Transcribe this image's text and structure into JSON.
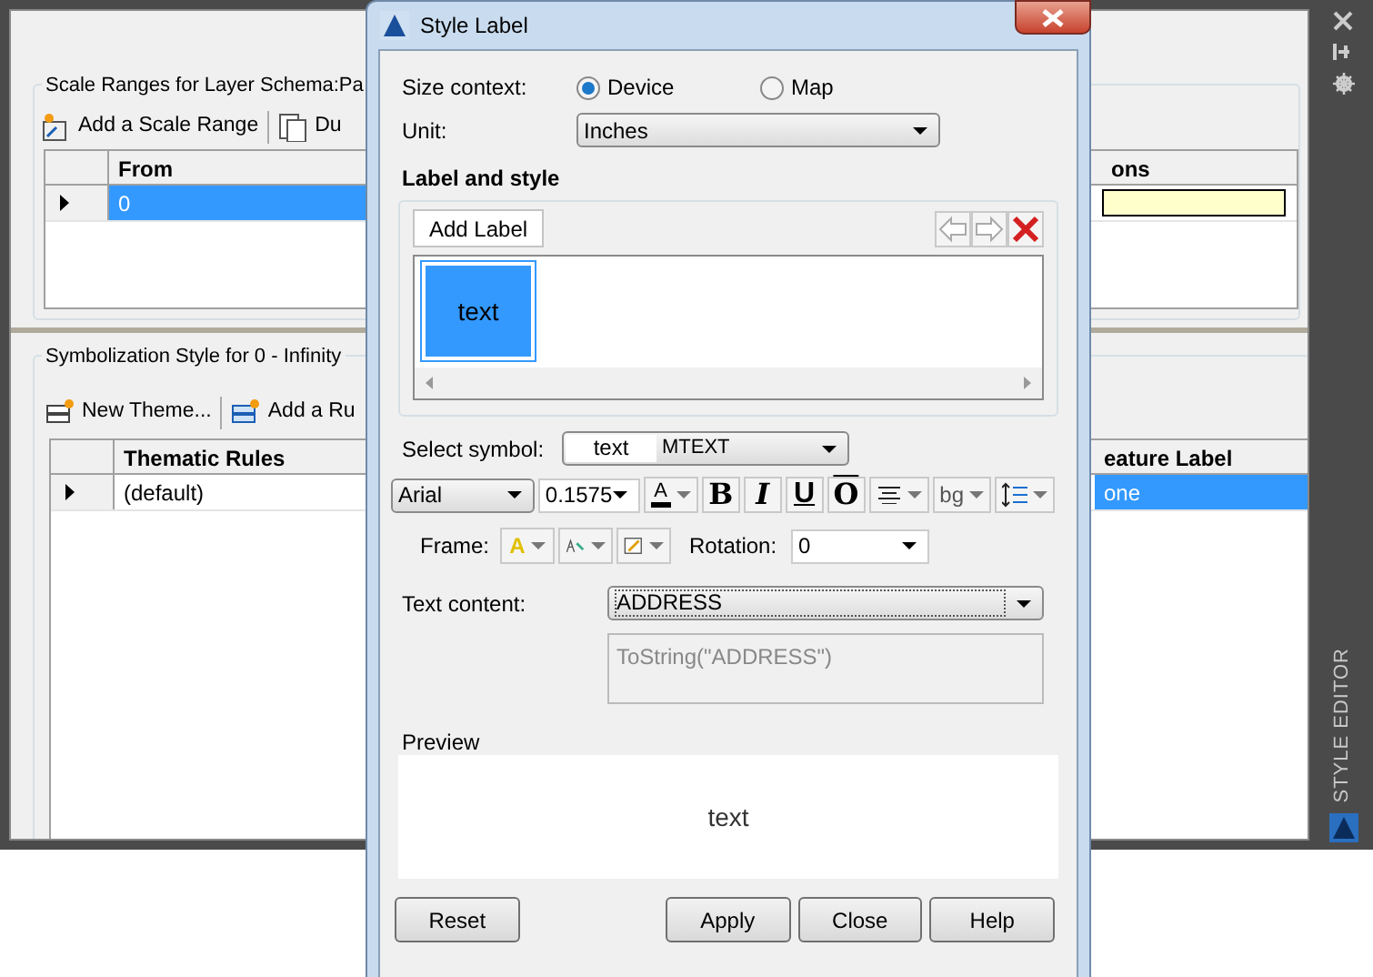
{
  "main_window": {
    "scale_ranges": {
      "title": "Scale Ranges for Layer Schema:Pa",
      "toolbar": [
        "Add a Scale Range",
        "Du"
      ],
      "columns": [
        "From",
        "ons"
      ],
      "rows": [
        {
          "cells": [
            {
              "text": "0",
              "selected": true
            }
          ],
          "editing": true
        }
      ]
    },
    "symbolization": {
      "title": "Symbolization Style for 0 - Infinity",
      "toolbar": [
        "New Theme...",
        "Add a Ru"
      ],
      "columns": [
        "Thematic Rules",
        "eature Label"
      ],
      "rows": [
        {
          "cells": [
            {
              "text": "(default)",
              "selected": false
            },
            {
              "text": "one",
              "selected": true
            }
          ]
        }
      ]
    }
  },
  "side_panel": {
    "title": "STYLE EDITOR"
  },
  "dialog": {
    "title": "Style Label",
    "size_context": {
      "label": "Size context:",
      "options": [
        {
          "label": "Device",
          "selected": true
        },
        {
          "label": "Map",
          "selected": false
        }
      ]
    },
    "unit": {
      "label": "Unit:",
      "value": "Inches"
    },
    "label_and_style": {
      "heading": "Label and style",
      "add_button": "Add Label",
      "labels": [
        {
          "text": "text",
          "selected": true
        }
      ]
    },
    "select_symbol": {
      "label": "Select symbol:",
      "sample": "text",
      "value": "MTEXT"
    },
    "font": {
      "family": "Arial",
      "size": "0.1575",
      "color_button": "A",
      "style_buttons": [
        "B",
        "I",
        "U",
        "O"
      ],
      "background_button": "bg"
    },
    "frame": {
      "label": "Frame:",
      "fill_button": "A"
    },
    "rotation": {
      "label": "Rotation:",
      "value": "0"
    },
    "text_content": {
      "label": "Text content:",
      "value": "ADDRESS",
      "expression": "ToString(\"ADDRESS\")"
    },
    "preview": {
      "label": "Preview",
      "text": "text"
    },
    "buttons": [
      "Reset",
      "Apply",
      "Close",
      "Help"
    ]
  }
}
